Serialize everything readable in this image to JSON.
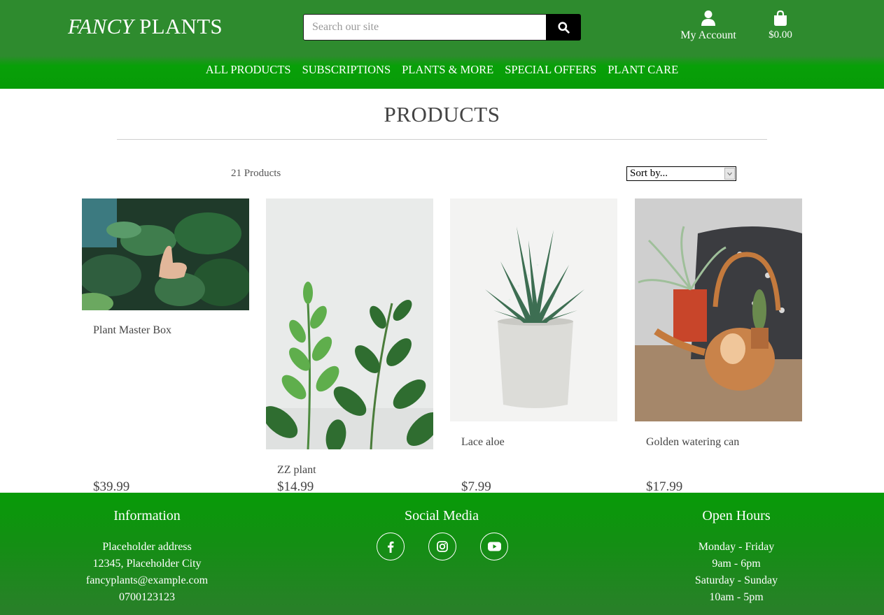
{
  "brand": {
    "part1": "FANCY",
    "part2": "PLANTS"
  },
  "search": {
    "placeholder": "Search our site",
    "icon": "search-icon"
  },
  "account": {
    "label": "My Account",
    "icon": "user-icon"
  },
  "cart": {
    "total": "$0.00",
    "icon": "shopping-bag-icon"
  },
  "nav": [
    "ALL PRODUCTS",
    "SUBSCRIPTIONS",
    "PLANTS & MORE",
    "SPECIAL OFFERS",
    "PLANT CARE"
  ],
  "main": {
    "title": "PRODUCTS",
    "count": "21 Products",
    "sort_selected": "Sort by..."
  },
  "products": [
    {
      "name": "Plant Master Box",
      "price": "$39.99"
    },
    {
      "name": "ZZ plant",
      "price": "$14.99"
    },
    {
      "name": "Lace aloe",
      "price": "$7.99"
    },
    {
      "name": "Golden watering can",
      "price": "$17.99"
    }
  ],
  "footer": {
    "information": {
      "title": "Information",
      "lines": [
        "Placeholder address",
        "12345, Placeholder City",
        "fancyplants@example.com",
        "0700123123"
      ]
    },
    "social": {
      "title": "Social Media",
      "icons": [
        "facebook-icon",
        "instagram-icon",
        "youtube-icon"
      ]
    },
    "hours": {
      "title": "Open Hours",
      "lines": [
        "Monday - Friday",
        "9am - 6pm",
        "Saturday - Sunday",
        "10am - 5pm"
      ]
    }
  },
  "colors": {
    "header": "#2e8b2e",
    "nav": "#079b07",
    "footer": "#138f13",
    "search_button": "#000000"
  }
}
